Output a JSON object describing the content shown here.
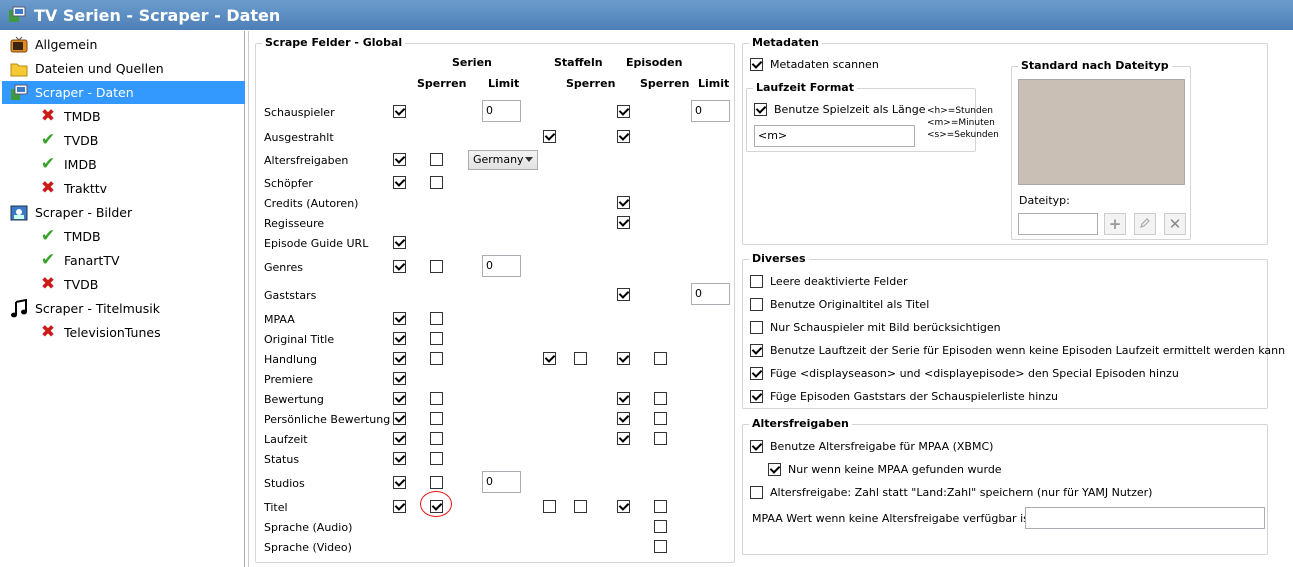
{
  "window": {
    "title": "TV Serien - Scraper - Daten"
  },
  "sidebar": {
    "items": [
      {
        "label": "Allgemein",
        "icon": "tv-icon",
        "level": 0,
        "selected": false
      },
      {
        "label": "Dateien und Quellen",
        "icon": "folder-icon",
        "level": 0,
        "selected": false
      },
      {
        "label": "Scraper - Daten",
        "icon": "scraper-data-icon",
        "level": 0,
        "selected": true
      },
      {
        "label": "TMDB",
        "icon": "red-x-icon",
        "level": 1,
        "selected": false
      },
      {
        "label": "TVDB",
        "icon": "green-check-icon",
        "level": 1,
        "selected": false
      },
      {
        "label": "IMDB",
        "icon": "green-check-icon",
        "level": 1,
        "selected": false
      },
      {
        "label": "Trakttv",
        "icon": "red-x-icon",
        "level": 1,
        "selected": false
      },
      {
        "label": "Scraper - Bilder",
        "icon": "picture-icon",
        "level": 0,
        "selected": false
      },
      {
        "label": "TMDB",
        "icon": "green-check-icon",
        "level": 1,
        "selected": false
      },
      {
        "label": "FanartTV",
        "icon": "green-check-icon",
        "level": 1,
        "selected": false
      },
      {
        "label": "TVDB",
        "icon": "red-x-icon",
        "level": 1,
        "selected": false
      },
      {
        "label": "Scraper - Titelmusik",
        "icon": "music-note-icon",
        "level": 0,
        "selected": false
      },
      {
        "label": "TelevisionTunes",
        "icon": "red-x-icon",
        "level": 1,
        "selected": false
      }
    ]
  },
  "scrape": {
    "legend": "Scrape Felder - Global",
    "headers": {
      "serien": "Serien",
      "staffeln": "Staffeln",
      "episoden": "Episoden",
      "sperren": "Sperren",
      "limit": "Limit"
    },
    "rows": [
      {
        "label": "Schauspieler",
        "s_on": true,
        "s_lock": null,
        "s_limit": "0",
        "st_on": null,
        "st_lock": null,
        "e_on": true,
        "e_lock": null,
        "e_limit": "0"
      },
      {
        "label": "Ausgestrahlt",
        "s_on": null,
        "s_lock": null,
        "s_limit": null,
        "st_on": true,
        "st_lock": null,
        "e_on": true,
        "e_lock": null,
        "e_limit": null
      },
      {
        "label": "Altersfreigaben",
        "s_on": true,
        "s_lock": false,
        "s_limit": null,
        "select": "Germany",
        "st_on": null,
        "st_lock": null,
        "e_on": null,
        "e_lock": null,
        "e_limit": null
      },
      {
        "label": "Schöpfer",
        "s_on": true,
        "s_lock": false,
        "s_limit": null,
        "st_on": null,
        "st_lock": null,
        "e_on": null,
        "e_lock": null,
        "e_limit": null
      },
      {
        "label": "Credits (Autoren)",
        "s_on": null,
        "s_lock": null,
        "s_limit": null,
        "st_on": null,
        "st_lock": null,
        "e_on": true,
        "e_lock": null,
        "e_limit": null
      },
      {
        "label": "Regisseure",
        "s_on": null,
        "s_lock": null,
        "s_limit": null,
        "st_on": null,
        "st_lock": null,
        "e_on": true,
        "e_lock": null,
        "e_limit": null
      },
      {
        "label": "Episode Guide URL",
        "s_on": true,
        "s_lock": null,
        "s_limit": null,
        "st_on": null,
        "st_lock": null,
        "e_on": null,
        "e_lock": null,
        "e_limit": null
      },
      {
        "label": "Genres",
        "s_on": true,
        "s_lock": false,
        "s_limit": "0",
        "st_on": null,
        "st_lock": null,
        "e_on": null,
        "e_lock": null,
        "e_limit": null
      },
      {
        "label": "Gaststars",
        "s_on": null,
        "s_lock": null,
        "s_limit": null,
        "st_on": null,
        "st_lock": null,
        "e_on": true,
        "e_lock": null,
        "e_limit": "0"
      },
      {
        "label": "MPAA",
        "s_on": true,
        "s_lock": false,
        "s_limit": null,
        "st_on": null,
        "st_lock": null,
        "e_on": null,
        "e_lock": null,
        "e_limit": null
      },
      {
        "label": "Original Title",
        "s_on": true,
        "s_lock": false,
        "s_limit": null,
        "st_on": null,
        "st_lock": null,
        "e_on": null,
        "e_lock": null,
        "e_limit": null
      },
      {
        "label": "Handlung",
        "s_on": true,
        "s_lock": false,
        "s_limit": null,
        "st_on": true,
        "st_lock": false,
        "e_on": true,
        "e_lock": false,
        "e_limit": null
      },
      {
        "label": "Premiere",
        "s_on": true,
        "s_lock": null,
        "s_limit": null,
        "st_on": null,
        "st_lock": null,
        "e_on": null,
        "e_lock": null,
        "e_limit": null
      },
      {
        "label": "Bewertung",
        "s_on": true,
        "s_lock": false,
        "s_limit": null,
        "st_on": null,
        "st_lock": null,
        "e_on": true,
        "e_lock": false,
        "e_limit": null
      },
      {
        "label": "Persönliche Bewertung",
        "s_on": true,
        "s_lock": false,
        "s_limit": null,
        "st_on": null,
        "st_lock": null,
        "e_on": true,
        "e_lock": false,
        "e_limit": null
      },
      {
        "label": "Laufzeit",
        "s_on": true,
        "s_lock": false,
        "s_limit": null,
        "st_on": null,
        "st_lock": null,
        "e_on": true,
        "e_lock": false,
        "e_limit": null
      },
      {
        "label": "Status",
        "s_on": true,
        "s_lock": false,
        "s_limit": null,
        "st_on": null,
        "st_lock": null,
        "e_on": null,
        "e_lock": null,
        "e_limit": null
      },
      {
        "label": "Studios",
        "s_on": true,
        "s_lock": false,
        "s_limit": "0",
        "st_on": null,
        "st_lock": null,
        "e_on": null,
        "e_lock": null,
        "e_limit": null
      },
      {
        "label": "Titel",
        "s_on": true,
        "s_lock": true,
        "s_limit": null,
        "st_on": false,
        "st_lock": false,
        "e_on": true,
        "e_lock": false,
        "e_limit": null
      },
      {
        "label": "Sprache (Audio)",
        "s_on": null,
        "s_lock": null,
        "s_limit": null,
        "st_on": null,
        "st_lock": null,
        "e_on": null,
        "e_lock": false,
        "e_limit": null
      },
      {
        "label": "Sprache (Video)",
        "s_on": null,
        "s_lock": null,
        "s_limit": null,
        "st_on": null,
        "st_lock": null,
        "e_on": null,
        "e_lock": false,
        "e_limit": null
      }
    ]
  },
  "metadaten": {
    "legend": "Metadaten",
    "scan_label": "Metadaten scannen",
    "scan_checked": true,
    "laufzeit_legend": "Laufzeit Format",
    "runtime_label": "Benutze Spielzeit als Länge",
    "runtime_checked": true,
    "format_value": "<m>",
    "hint_h": "<h>=Stunden",
    "hint_m": "<m>=Minuten",
    "hint_s": "<s>=Sekunden",
    "standard_legend": "Standard nach Dateityp",
    "dateityp_label": "Dateityp:",
    "dateityp_value": ""
  },
  "diverses": {
    "legend": "Diverses",
    "options": [
      {
        "label": "Leere deaktivierte Felder",
        "checked": false
      },
      {
        "label": "Benutze Originaltitel als Titel",
        "checked": false
      },
      {
        "label": "Nur Schauspieler mit Bild berücksichtigen",
        "checked": false
      },
      {
        "label": "Benutze Lauftzeit der Serie für Episoden wenn keine Episoden Laufzeit ermittelt werden kann",
        "checked": true
      },
      {
        "label": "Füge <displayseason> und <displayepisode> den Special Episoden hinzu",
        "checked": true
      },
      {
        "label": "Füge Episoden Gaststars der Schauspielerliste hinzu",
        "checked": true
      }
    ]
  },
  "altersfreigaben": {
    "legend": "Altersfreigaben",
    "mpaa_label": "Benutze Altersfreigabe für MPAA (XBMC)",
    "mpaa_checked": true,
    "only_label": "Nur wenn keine MPAA gefunden wurde",
    "only_checked": true,
    "yamj_label": "Altersfreigabe: Zahl statt \"Land:Zahl\" speichern (nur für YAMJ Nutzer)",
    "yamj_checked": false,
    "fallback_label": "MPAA Wert wenn keine Altersfreigabe verfügbar ist",
    "fallback_value": ""
  }
}
